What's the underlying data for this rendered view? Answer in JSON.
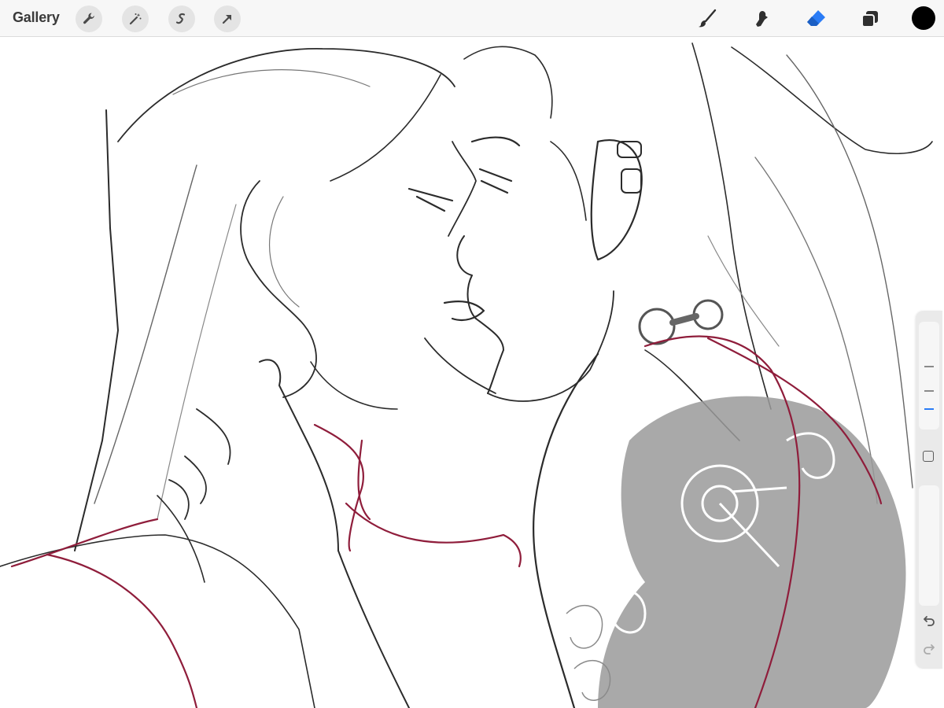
{
  "app": {
    "gallery_label": "Gallery"
  },
  "toolbar": {
    "left_icons": [
      "wrench-icon",
      "magic-wand-icon",
      "selection-icon",
      "transform-arrow-icon"
    ],
    "right_icons": [
      "brush-icon",
      "smudge-icon",
      "eraser-icon",
      "layers-icon"
    ],
    "active_tool": "eraser",
    "accent_color": "#2a7cf6",
    "current_color": "#000000"
  },
  "sidebar": {
    "size_slider_level": 0.78,
    "controls": [
      "modify-button",
      "undo-button",
      "redo-button"
    ]
  },
  "canvas": {
    "line_color": "#2b2b2b",
    "sketch_color": "#8f1d3b",
    "tattoo_color": "#9a9a9a"
  }
}
